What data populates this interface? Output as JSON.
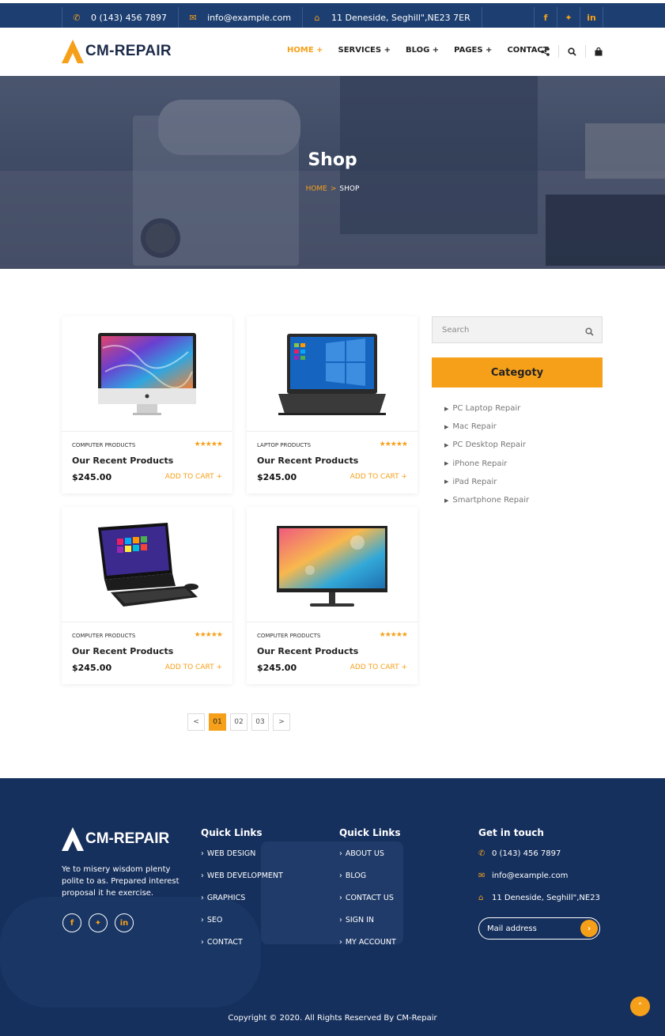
{
  "topbar": {
    "phone": "0 (143) 456 7897",
    "email": "info@example.com",
    "address": "11 Deneside, Seghill\",NE23 7ER",
    "social": [
      "f",
      "tw",
      "in"
    ]
  },
  "brand": {
    "name": "CM-REPAIR",
    "accent": "#f6a01a",
    "navy": "#1c3e70"
  },
  "nav": {
    "items": [
      "HOME +",
      "SERVICES +",
      "BLOG +",
      "PAGES +",
      "CONTACT"
    ],
    "active_index": 0,
    "icons": [
      "share-icon",
      "search-icon",
      "bag-icon"
    ]
  },
  "hero": {
    "title": "Shop",
    "breadcrumb_home": "HOME",
    "breadcrumb_sep": ">",
    "breadcrumb_current": "SHOP"
  },
  "products": [
    {
      "category": "COMPUTER PRODUCTS",
      "rating": 5,
      "title": "Our Recent Products",
      "price": "$245.00",
      "cta": "ADD TO CART +",
      "image": "imac-icon"
    },
    {
      "category": "LAPTOP PRODUCTS",
      "rating": 5,
      "title": "Our Recent Products",
      "price": "$245.00",
      "cta": "ADD TO CART +",
      "image": "laptop-icon"
    },
    {
      "category": "COMPUTER PRODUCTS",
      "rating": 5,
      "title": "Our Recent Products",
      "price": "$245.00",
      "cta": "ADD TO CART +",
      "image": "all-in-one-pc-icon"
    },
    {
      "category": "COMPUTER PRODUCTS",
      "rating": 5,
      "title": "Our Recent Products",
      "price": "$245.00",
      "cta": "ADD TO CART +",
      "image": "monitor-icon"
    }
  ],
  "pagination": {
    "prev": "<",
    "pages": [
      "01",
      "02",
      "03"
    ],
    "current": "01",
    "next": ">"
  },
  "sidebar": {
    "search_placeholder": "Search",
    "category_title": "Categoty",
    "categories": [
      "PC Laptop Repair",
      "Mac Repair",
      "PC Desktop Repair",
      "iPhone Repair",
      "iPad Repair",
      "Smartphone Repair"
    ]
  },
  "footer": {
    "about": "Ye to misery wisdom plenty polite to as. Prepared interest proposal it he exercise.",
    "social": [
      "f",
      "tw",
      "in"
    ],
    "col1": {
      "title": "Quick Links",
      "links": [
        "WEB DESIGN",
        "WEB DEVELOPMENT",
        "GRAPHICS",
        "SEO",
        "CONTACT"
      ]
    },
    "col2": {
      "title": "Quick Links",
      "links": [
        "ABOUT US",
        "BLOG",
        "CONTACT US",
        "SIGN IN",
        "MY ACCOUNT"
      ]
    },
    "contact": {
      "title": "Get in touch",
      "phone": "0 (143) 456 7897",
      "email": "info@example.com",
      "address": "11 Deneside, Seghill\",NE23"
    },
    "mail_placeholder": "Mail address",
    "copyright": "Copyright © 2020. All Rights Reserved By CM-Repair"
  }
}
